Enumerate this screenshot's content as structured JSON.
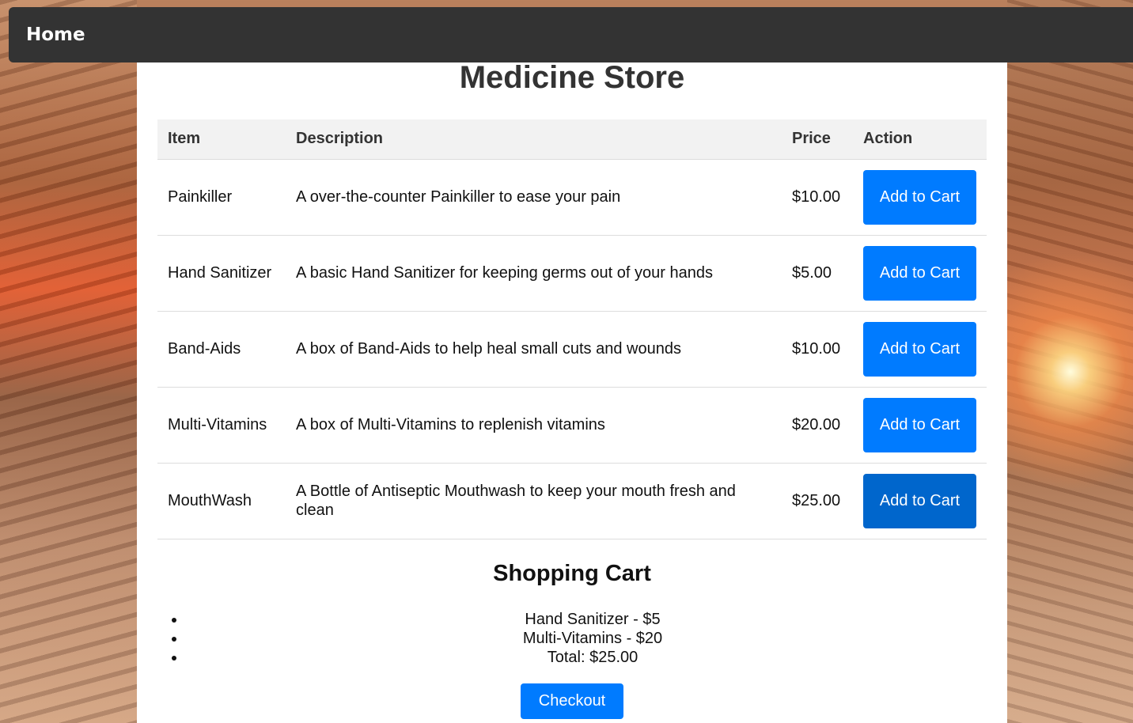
{
  "nav": {
    "home_label": "Home"
  },
  "store": {
    "title": "Medicine Store"
  },
  "table": {
    "headers": {
      "item": "Item",
      "description": "Description",
      "price": "Price",
      "action": "Action"
    },
    "rows": [
      {
        "item": "Painkiller",
        "description": "A over-the-counter Painkiller to ease your pain",
        "price": "$10.00",
        "action_label": "Add to Cart"
      },
      {
        "item": "Hand Sanitizer",
        "description": "A basic Hand Sanitizer for keeping germs out of your hands",
        "price": "$5.00",
        "action_label": "Add to Cart"
      },
      {
        "item": "Band-Aids",
        "description": "A box of Band-Aids to help heal small cuts and wounds",
        "price": "$10.00",
        "action_label": "Add to Cart"
      },
      {
        "item": "Multi-Vitamins",
        "description": "A box of Multi-Vitamins to replenish vitamins",
        "price": "$20.00",
        "action_label": "Add to Cart"
      },
      {
        "item": "MouthWash",
        "description": "A Bottle of Antiseptic Mouthwash to keep your mouth fresh and clean",
        "price": "$25.00",
        "action_label": "Add to Cart"
      }
    ]
  },
  "cart": {
    "title": "Shopping Cart",
    "items": [
      "Hand Sanitizer - $5",
      "Multi-Vitamins - $20",
      "Total: $25.00"
    ],
    "checkout_label": "Checkout"
  },
  "colors": {
    "navbar_bg": "#333333",
    "primary_button": "#007bff",
    "primary_button_hover": "#0066cc",
    "header_row_bg": "#f2f2f2"
  }
}
